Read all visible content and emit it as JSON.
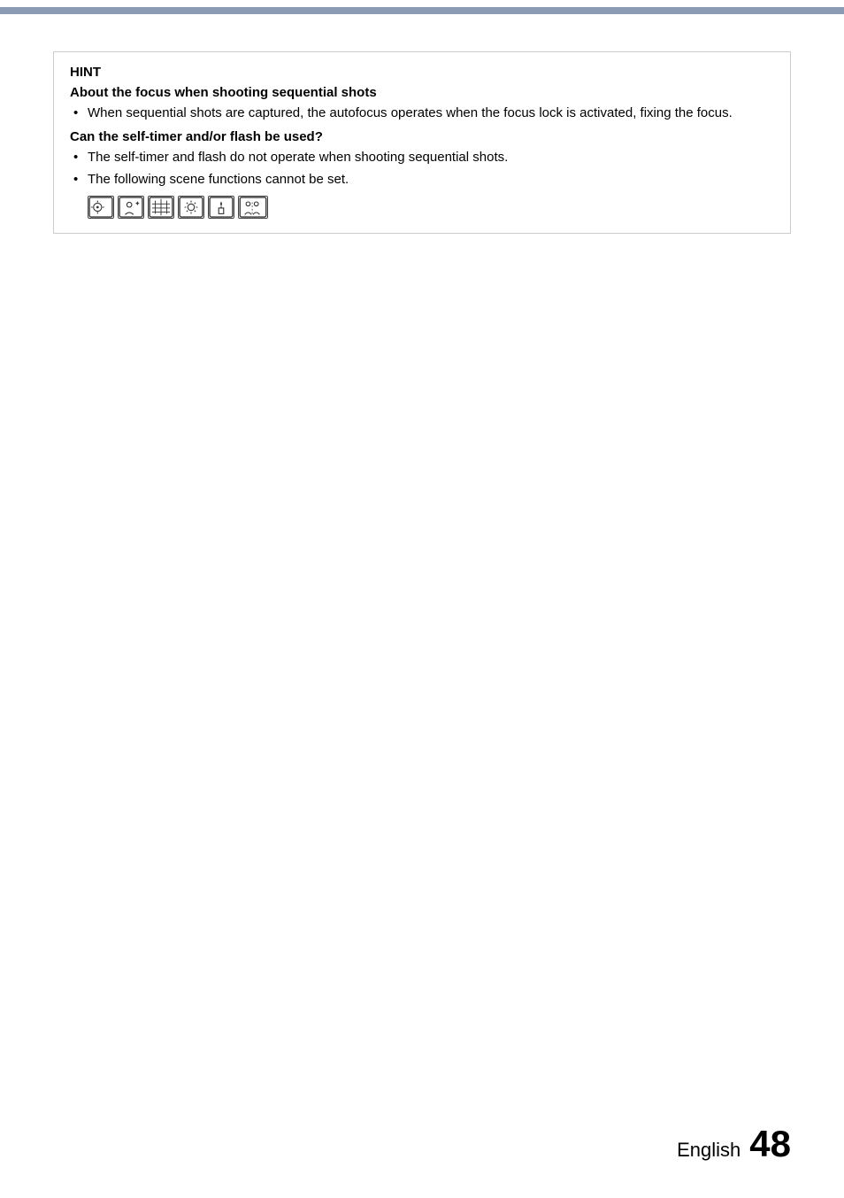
{
  "top_bar": {
    "color": "#8B9BB4"
  },
  "hint_section": {
    "label": "HINT",
    "heading1": "About the focus when shooting sequential shots",
    "bullet1": "When sequential shots are captured, the autofocus operates when the focus lock is activated, fixing the focus.",
    "heading2": "Can the self-timer and/or flash be used?",
    "bullet2": "The self-timer and flash do not operate when shooting sequential shots.",
    "bullet3": "The following scene functions cannot be set."
  },
  "footer": {
    "language": "English",
    "page_number": "48"
  }
}
